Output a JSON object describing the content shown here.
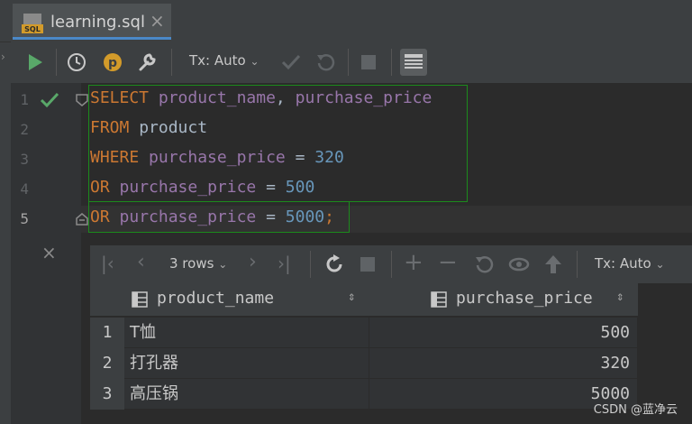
{
  "tab": {
    "title": "learning.sql",
    "icon_label": "SQL"
  },
  "toolbar": {
    "tx_mode": "Tx: Auto"
  },
  "editor": {
    "line_numbers": [
      "1",
      "2",
      "3",
      "4",
      "5"
    ],
    "lines": [
      [
        {
          "t": "SELECT",
          "c": "kw"
        },
        {
          "t": " ",
          "c": "op"
        },
        {
          "t": "product_name",
          "c": "col"
        },
        {
          "t": ", ",
          "c": "op"
        },
        {
          "t": "purchase_price",
          "c": "col"
        }
      ],
      [
        {
          "t": "FROM",
          "c": "kw"
        },
        {
          "t": " ",
          "c": "op"
        },
        {
          "t": "product",
          "c": "tbl"
        }
      ],
      [
        {
          "t": "WHERE",
          "c": "kw"
        },
        {
          "t": " ",
          "c": "op"
        },
        {
          "t": "purchase_price",
          "c": "col"
        },
        {
          "t": " = ",
          "c": "op"
        },
        {
          "t": "320",
          "c": "num"
        }
      ],
      [
        {
          "t": "OR",
          "c": "kw"
        },
        {
          "t": " ",
          "c": "op"
        },
        {
          "t": "purchase_price",
          "c": "col"
        },
        {
          "t": " = ",
          "c": "op"
        },
        {
          "t": "500",
          "c": "num"
        }
      ],
      [
        {
          "t": "OR",
          "c": "kw"
        },
        {
          "t": " ",
          "c": "op"
        },
        {
          "t": "purchase_price",
          "c": "col"
        },
        {
          "t": " = ",
          "c": "op"
        },
        {
          "t": "5000",
          "c": "num"
        },
        {
          "t": ";",
          "c": "semi"
        }
      ]
    ]
  },
  "results": {
    "row_count": "3 rows",
    "tx_mode": "Tx: Auto",
    "columns": [
      "product_name",
      "purchase_price"
    ],
    "row_numbers": [
      "1",
      "2",
      "3"
    ],
    "rows": [
      [
        "T恤",
        "500"
      ],
      [
        "打孔器",
        "320"
      ],
      [
        "高压锅",
        "5000"
      ]
    ]
  },
  "watermark": "CSDN @蓝净云",
  "colors": {
    "accent": "#4a88c7",
    "run_green": "#59a869",
    "selection_border": "#1c8a1c"
  }
}
